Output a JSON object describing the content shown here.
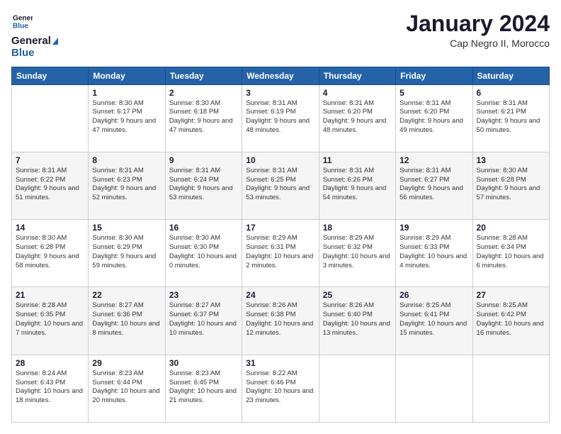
{
  "logo": {
    "line1": "General",
    "line2": "Blue"
  },
  "title": "January 2024",
  "subtitle": "Cap Negro II, Morocco",
  "header_days": [
    "Sunday",
    "Monday",
    "Tuesday",
    "Wednesday",
    "Thursday",
    "Friday",
    "Saturday"
  ],
  "weeks": [
    [
      {
        "day": "",
        "sunrise": "",
        "sunset": "",
        "daylight": ""
      },
      {
        "day": "1",
        "sunrise": "Sunrise: 8:30 AM",
        "sunset": "Sunset: 6:17 PM",
        "daylight": "Daylight: 9 hours and 47 minutes."
      },
      {
        "day": "2",
        "sunrise": "Sunrise: 8:30 AM",
        "sunset": "Sunset: 6:18 PM",
        "daylight": "Daylight: 9 hours and 47 minutes."
      },
      {
        "day": "3",
        "sunrise": "Sunrise: 8:31 AM",
        "sunset": "Sunset: 6:19 PM",
        "daylight": "Daylight: 9 hours and 48 minutes."
      },
      {
        "day": "4",
        "sunrise": "Sunrise: 8:31 AM",
        "sunset": "Sunset: 6:20 PM",
        "daylight": "Daylight: 9 hours and 48 minutes."
      },
      {
        "day": "5",
        "sunrise": "Sunrise: 8:31 AM",
        "sunset": "Sunset: 6:20 PM",
        "daylight": "Daylight: 9 hours and 49 minutes."
      },
      {
        "day": "6",
        "sunrise": "Sunrise: 8:31 AM",
        "sunset": "Sunset: 6:21 PM",
        "daylight": "Daylight: 9 hours and 50 minutes."
      }
    ],
    [
      {
        "day": "7",
        "sunrise": "Sunrise: 8:31 AM",
        "sunset": "Sunset: 6:22 PM",
        "daylight": "Daylight: 9 hours and 51 minutes."
      },
      {
        "day": "8",
        "sunrise": "Sunrise: 8:31 AM",
        "sunset": "Sunset: 6:23 PM",
        "daylight": "Daylight: 9 hours and 52 minutes."
      },
      {
        "day": "9",
        "sunrise": "Sunrise: 8:31 AM",
        "sunset": "Sunset: 6:24 PM",
        "daylight": "Daylight: 9 hours and 53 minutes."
      },
      {
        "day": "10",
        "sunrise": "Sunrise: 8:31 AM",
        "sunset": "Sunset: 6:25 PM",
        "daylight": "Daylight: 9 hours and 53 minutes."
      },
      {
        "day": "11",
        "sunrise": "Sunrise: 8:31 AM",
        "sunset": "Sunset: 6:26 PM",
        "daylight": "Daylight: 9 hours and 54 minutes."
      },
      {
        "day": "12",
        "sunrise": "Sunrise: 8:31 AM",
        "sunset": "Sunset: 6:27 PM",
        "daylight": "Daylight: 9 hours and 56 minutes."
      },
      {
        "day": "13",
        "sunrise": "Sunrise: 8:30 AM",
        "sunset": "Sunset: 6:28 PM",
        "daylight": "Daylight: 9 hours and 57 minutes."
      }
    ],
    [
      {
        "day": "14",
        "sunrise": "Sunrise: 8:30 AM",
        "sunset": "Sunset: 6:28 PM",
        "daylight": "Daylight: 9 hours and 58 minutes."
      },
      {
        "day": "15",
        "sunrise": "Sunrise: 8:30 AM",
        "sunset": "Sunset: 6:29 PM",
        "daylight": "Daylight: 9 hours and 59 minutes."
      },
      {
        "day": "16",
        "sunrise": "Sunrise: 8:30 AM",
        "sunset": "Sunset: 6:30 PM",
        "daylight": "Daylight: 10 hours and 0 minutes."
      },
      {
        "day": "17",
        "sunrise": "Sunrise: 8:29 AM",
        "sunset": "Sunset: 6:31 PM",
        "daylight": "Daylight: 10 hours and 2 minutes."
      },
      {
        "day": "18",
        "sunrise": "Sunrise: 8:29 AM",
        "sunset": "Sunset: 6:32 PM",
        "daylight": "Daylight: 10 hours and 3 minutes."
      },
      {
        "day": "19",
        "sunrise": "Sunrise: 8:29 AM",
        "sunset": "Sunset: 6:33 PM",
        "daylight": "Daylight: 10 hours and 4 minutes."
      },
      {
        "day": "20",
        "sunrise": "Sunrise: 8:28 AM",
        "sunset": "Sunset: 6:34 PM",
        "daylight": "Daylight: 10 hours and 6 minutes."
      }
    ],
    [
      {
        "day": "21",
        "sunrise": "Sunrise: 8:28 AM",
        "sunset": "Sunset: 6:35 PM",
        "daylight": "Daylight: 10 hours and 7 minutes."
      },
      {
        "day": "22",
        "sunrise": "Sunrise: 8:27 AM",
        "sunset": "Sunset: 6:36 PM",
        "daylight": "Daylight: 10 hours and 8 minutes."
      },
      {
        "day": "23",
        "sunrise": "Sunrise: 8:27 AM",
        "sunset": "Sunset: 6:37 PM",
        "daylight": "Daylight: 10 hours and 10 minutes."
      },
      {
        "day": "24",
        "sunrise": "Sunrise: 8:26 AM",
        "sunset": "Sunset: 6:38 PM",
        "daylight": "Daylight: 10 hours and 12 minutes."
      },
      {
        "day": "25",
        "sunrise": "Sunrise: 8:26 AM",
        "sunset": "Sunset: 6:40 PM",
        "daylight": "Daylight: 10 hours and 13 minutes."
      },
      {
        "day": "26",
        "sunrise": "Sunrise: 8:25 AM",
        "sunset": "Sunset: 6:41 PM",
        "daylight": "Daylight: 10 hours and 15 minutes."
      },
      {
        "day": "27",
        "sunrise": "Sunrise: 8:25 AM",
        "sunset": "Sunset: 6:42 PM",
        "daylight": "Daylight: 10 hours and 16 minutes."
      }
    ],
    [
      {
        "day": "28",
        "sunrise": "Sunrise: 8:24 AM",
        "sunset": "Sunset: 6:43 PM",
        "daylight": "Daylight: 10 hours and 18 minutes."
      },
      {
        "day": "29",
        "sunrise": "Sunrise: 8:23 AM",
        "sunset": "Sunset: 6:44 PM",
        "daylight": "Daylight: 10 hours and 20 minutes."
      },
      {
        "day": "30",
        "sunrise": "Sunrise: 8:23 AM",
        "sunset": "Sunset: 6:45 PM",
        "daylight": "Daylight: 10 hours and 21 minutes."
      },
      {
        "day": "31",
        "sunrise": "Sunrise: 8:22 AM",
        "sunset": "Sunset: 6:46 PM",
        "daylight": "Daylight: 10 hours and 23 minutes."
      },
      {
        "day": "",
        "sunrise": "",
        "sunset": "",
        "daylight": ""
      },
      {
        "day": "",
        "sunrise": "",
        "sunset": "",
        "daylight": ""
      },
      {
        "day": "",
        "sunrise": "",
        "sunset": "",
        "daylight": ""
      }
    ]
  ]
}
